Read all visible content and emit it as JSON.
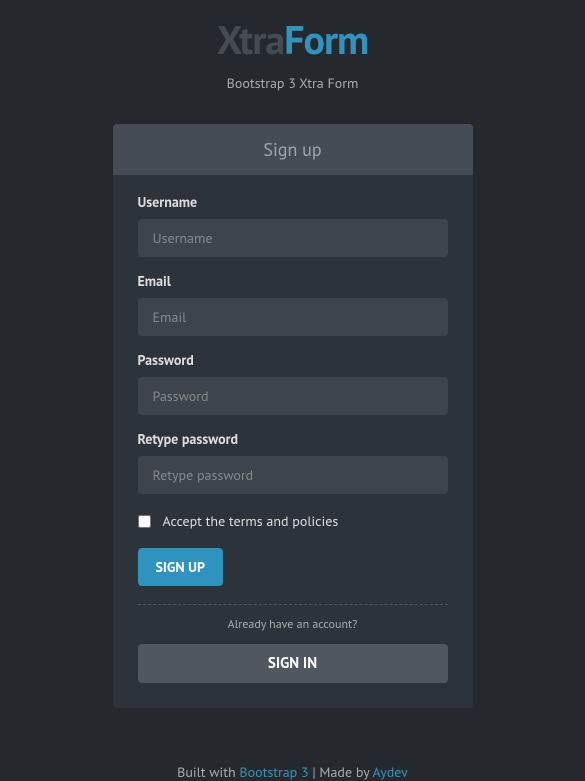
{
  "logo": {
    "part1": "Xtra",
    "part2": "Form"
  },
  "tagline": "Bootstrap 3 Xtra Form",
  "card": {
    "header": "Sign up"
  },
  "form": {
    "username": {
      "label": "Username",
      "placeholder": "Username"
    },
    "email": {
      "label": "Email",
      "placeholder": "Email"
    },
    "password": {
      "label": "Password",
      "placeholder": "Password"
    },
    "retype": {
      "label": "Retype password",
      "placeholder": "Retype password"
    },
    "terms": {
      "label": "Accept the terms and policies"
    },
    "signup_button": "Sign up",
    "already_text": "Already have an account?",
    "signin_button": "Sign in"
  },
  "footer": {
    "built_with": "Built with ",
    "bootstrap_link": "Bootstrap 3",
    "separator": " | Made by ",
    "aydev_link": "Aydev"
  }
}
